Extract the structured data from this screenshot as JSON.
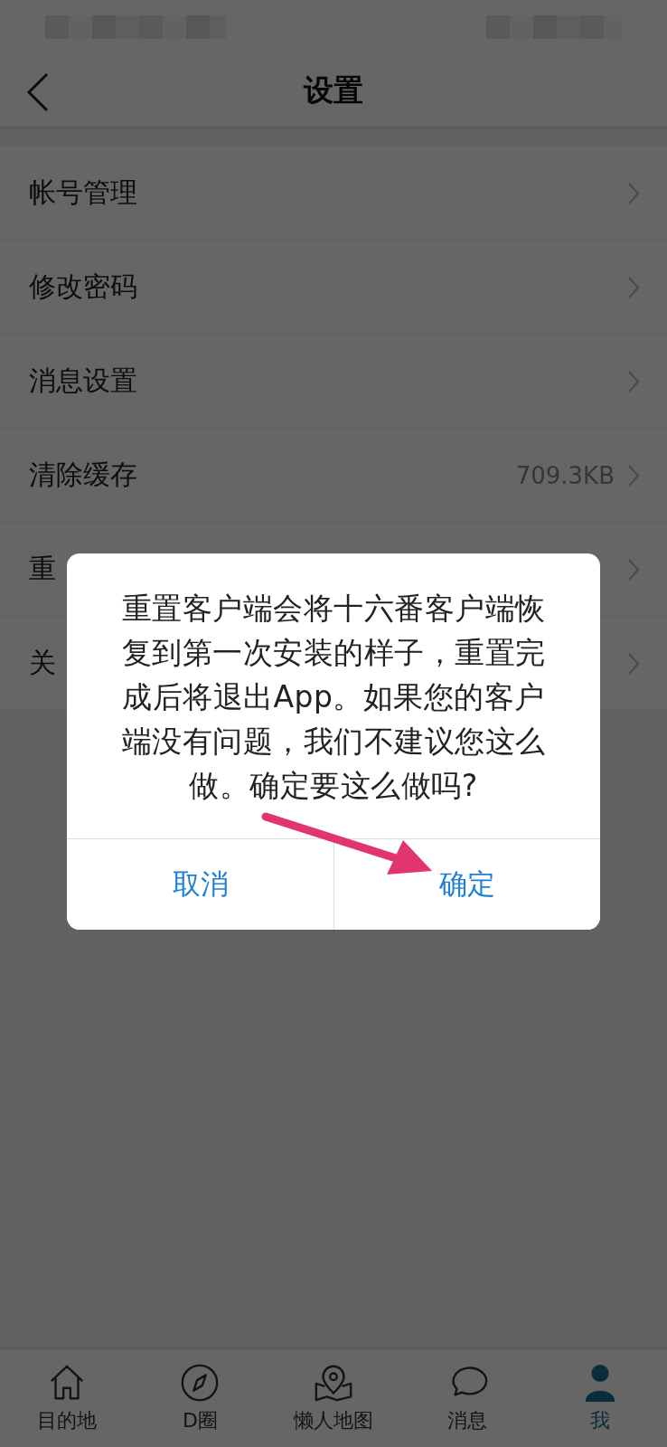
{
  "header": {
    "title": "设置"
  },
  "settings": [
    {
      "label": "帐号管理"
    },
    {
      "label": "修改密码"
    },
    {
      "label": "消息设置"
    },
    {
      "label": "清除缓存",
      "value": "709.3KB"
    },
    {
      "label": "重"
    },
    {
      "label": "关"
    }
  ],
  "dialog": {
    "message": "重置客户端会将十六番客户端恢复到第一次安装的样子，重置完成后将退出App。如果您的客户端没有问题，我们不建议您这么做。确定要这么做吗?",
    "buttons": [
      {
        "label": "取消"
      },
      {
        "label": "确定"
      }
    ]
  },
  "tab_bar": [
    {
      "label": "目的地",
      "kind": "home",
      "selected": false
    },
    {
      "label": "D圈",
      "kind": "compass",
      "selected": false
    },
    {
      "label": "懒人地图",
      "kind": "map",
      "selected": false
    },
    {
      "label": "消息",
      "kind": "chat",
      "selected": false
    },
    {
      "label": "我",
      "kind": "person",
      "selected": true
    }
  ]
}
